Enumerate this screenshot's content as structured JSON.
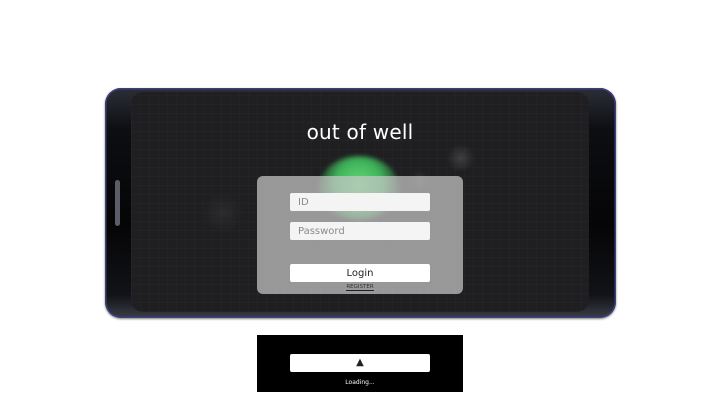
{
  "app": {
    "title": "out of well"
  },
  "login": {
    "id_placeholder": "ID",
    "id_value": "",
    "password_placeholder": "Password",
    "password_value": "",
    "login_label": "Login",
    "register_label": "REGISTER"
  },
  "loading": {
    "icon": "up-triangle-icon",
    "icon_glyph": "▲",
    "text": "Loading..."
  },
  "colors": {
    "frame_accent": "#3b3f7a",
    "orb_green": "#3fb35a",
    "panel_overlay": "#c8c8c8",
    "loading_background": "#000000"
  }
}
